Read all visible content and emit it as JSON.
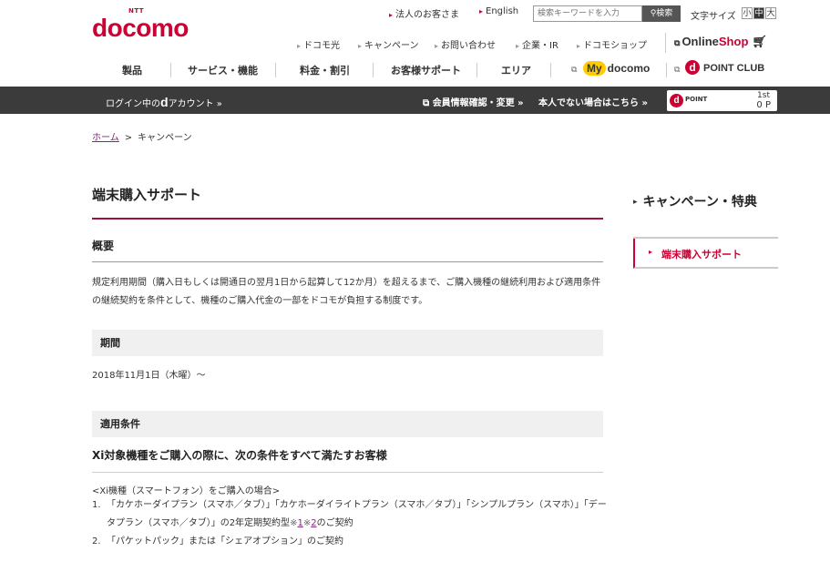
{
  "logo": {
    "ntt": "NTT",
    "word": "docomo"
  },
  "utility": {
    "corporate": "法人のお客さま",
    "english": "English",
    "search_placeholder": "検索キーワードを入力",
    "search_button": "検索",
    "font_size_label": "文字サイズ",
    "font_sizes": [
      "小",
      "中",
      "大"
    ]
  },
  "sub_nav": [
    "ドコモ光",
    "キャンペーン",
    "お問い合わせ",
    "企業・IR",
    "ドコモショップ"
  ],
  "online_shop": {
    "online": "Online",
    "shop": "Shop"
  },
  "main_nav": [
    "製品",
    "サービス・機能",
    "料金・割引",
    "お客様サポート",
    "エリア"
  ],
  "my_docomo": {
    "my": "My",
    "word": "docomo"
  },
  "dpoint_club": {
    "d": "d",
    "label": "POINT CLUB"
  },
  "bar": {
    "login_prefix": "ログイン中の",
    "login_d": "d",
    "login_suffix": "アカウント »",
    "member_info": "会員情報確認・変更 »",
    "not_me": "本人でない場合はこちら »",
    "dpoint_label": "POINT",
    "rank": "1st",
    "points": "0 P"
  },
  "breadcrumb": {
    "home": "ホーム",
    "current": "キャンペーン"
  },
  "main": {
    "title": "端末購入サポート",
    "overview_heading": "概要",
    "overview_text": "規定利用期間（購入日もしくは開通日の翌月1日から起算して12か月）を超えるまで、ご購入機種の継続利用および適用条件の継続契約を条件として、機種のご購入代金の一部をドコモが負担する制度です。",
    "period_heading": "期間",
    "period_text": "2018年11月1日（木曜）～",
    "conditions_heading": "適用条件",
    "conditions_subheading": "Xi対象機種をご購入の際に、次の条件をすべて満たすお客様",
    "smartphone_label": "<Xi機種（スマートフォン）をご購入の場合>",
    "list": [
      {
        "num": "1.",
        "text": "「カケホーダイプラン（スマホ／タブ）」「カケホーダイライトプラン（スマホ／タブ）」「シンプルプラン（スマホ）」「データプラン（スマホ／タブ）」の2年定期契約型",
        "kome1": "※1",
        "kome2": "※2",
        "tail": "のご契約"
      },
      {
        "num": "2.",
        "text": "「パケットパック」または「シェアオプション」のご契約"
      }
    ]
  },
  "sidebar": {
    "title": "キャンペーン・特典",
    "item": "端末購入サポート"
  },
  "colors": {
    "brand": "#cc0033",
    "bar": "#3b3b3b"
  }
}
